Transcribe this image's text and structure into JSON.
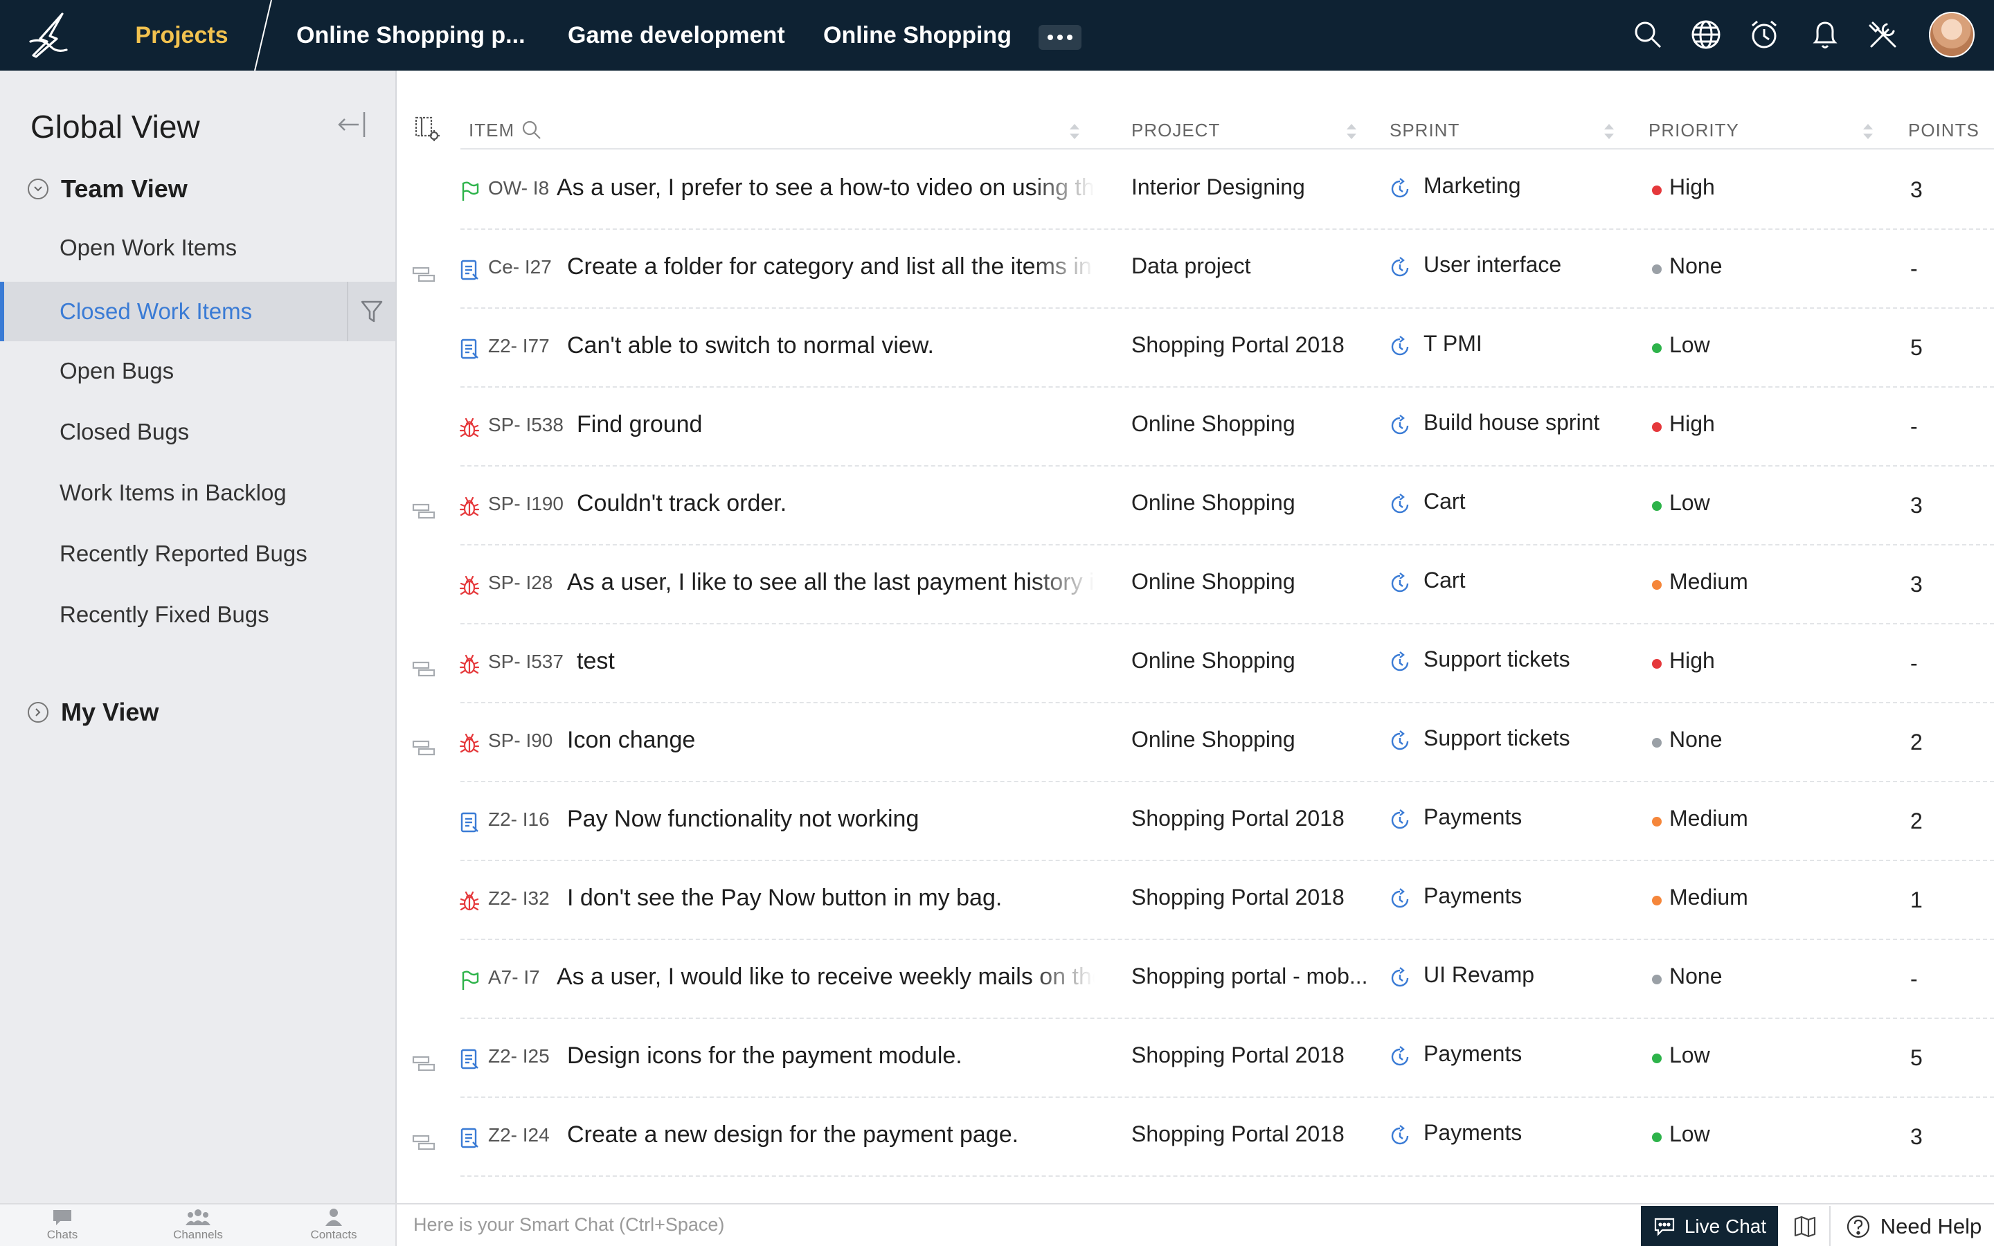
{
  "topbar": {
    "projects_label": "Projects",
    "tabs": [
      "Online Shopping p...",
      "Game development",
      "Online Shopping"
    ],
    "icons": [
      "search-icon",
      "globe-icon",
      "clock-icon",
      "bell-icon",
      "tools-icon"
    ]
  },
  "sidebar": {
    "title": "Global View",
    "team_view": "Team View",
    "items": [
      {
        "label": "Open Work Items",
        "active": false
      },
      {
        "label": "Closed Work Items",
        "active": true
      },
      {
        "label": "Open Bugs",
        "active": false
      },
      {
        "label": "Closed Bugs",
        "active": false
      },
      {
        "label": "Work Items in Backlog",
        "active": false
      },
      {
        "label": "Recently Reported Bugs",
        "active": false
      },
      {
        "label": "Recently Fixed Bugs",
        "active": false
      }
    ],
    "my_view": "My View"
  },
  "table": {
    "columns": [
      "ITEM",
      "PROJECT",
      "SPRINT",
      "PRIORITY",
      "POINTS"
    ],
    "rows": [
      {
        "subtask": false,
        "type": "story",
        "id": "OW- I8",
        "title": "As a user, I prefer to see a how-to video on using the app.",
        "project": "Interior Designing",
        "sprint": "Marketing",
        "priority": "High",
        "points": "3"
      },
      {
        "subtask": true,
        "type": "task",
        "id": "Ce- I27",
        "title": "Create a folder for category and list all the items in it.",
        "project": "Data project",
        "sprint": "User interface",
        "priority": "None",
        "points": "-"
      },
      {
        "subtask": false,
        "type": "task",
        "id": "Z2- I77",
        "title": "Can't able to switch to normal view.",
        "project": "Shopping Portal 2018",
        "sprint": "T PMI",
        "priority": "Low",
        "points": "5"
      },
      {
        "subtask": false,
        "type": "bug",
        "id": "SP- I538",
        "title": "Find ground",
        "project": "Online Shopping",
        "sprint": "Build house sprint",
        "priority": "High",
        "points": "-"
      },
      {
        "subtask": true,
        "type": "bug",
        "id": "SP- I190",
        "title": "Couldn't track order.",
        "project": "Online Shopping",
        "sprint": "Cart",
        "priority": "Low",
        "points": "3"
      },
      {
        "subtask": false,
        "type": "bug",
        "id": "SP- I28",
        "title": "As a user, I like to see all the last payment history in my account.",
        "project": "Online Shopping",
        "sprint": "Cart",
        "priority": "Medium",
        "points": "3"
      },
      {
        "subtask": true,
        "type": "bug",
        "id": "SP- I537",
        "title": "test",
        "project": "Online Shopping",
        "sprint": "Support tickets",
        "priority": "High",
        "points": "-"
      },
      {
        "subtask": true,
        "type": "bug",
        "id": "SP- I90",
        "title": "Icon change",
        "project": "Online Shopping",
        "sprint": "Support tickets",
        "priority": "None",
        "points": "2"
      },
      {
        "subtask": false,
        "type": "task",
        "id": "Z2- I16",
        "title": "Pay Now functionality not working",
        "project": "Shopping Portal 2018",
        "sprint": "Payments",
        "priority": "Medium",
        "points": "2"
      },
      {
        "subtask": false,
        "type": "bug",
        "id": "Z2- I32",
        "title": "I don't see the Pay Now button in my bag.",
        "project": "Shopping Portal 2018",
        "sprint": "Payments",
        "priority": "Medium",
        "points": "1"
      },
      {
        "subtask": false,
        "type": "story",
        "id": "A7- I7",
        "title": "As a user, I would like to receive weekly mails on the latest offers.",
        "project": "Shopping portal - mob...",
        "sprint": "UI Revamp",
        "priority": "None",
        "points": "-"
      },
      {
        "subtask": true,
        "type": "task",
        "id": "Z2- I25",
        "title": "Design icons for the payment module.",
        "project": "Shopping Portal 2018",
        "sprint": "Payments",
        "priority": "Low",
        "points": "5"
      },
      {
        "subtask": true,
        "type": "task",
        "id": "Z2- I24",
        "title": "Create a new design for the payment page.",
        "project": "Shopping Portal 2018",
        "sprint": "Payments",
        "priority": "Low",
        "points": "3"
      }
    ]
  },
  "priority_colors": {
    "High": "#e5383b",
    "Low": "#2db34a",
    "Medium": "#f5863a",
    "None": "#9aa0a6"
  },
  "type_colors": {
    "story": "#2db34a",
    "task": "#3a7bd5",
    "bug": "#e5383b"
  },
  "bottombar": {
    "chats": "Chats",
    "channels": "Channels",
    "contacts": "Contacts",
    "smart_chat_placeholder": "Here is your Smart Chat (Ctrl+Space)",
    "live_chat": "Live Chat",
    "need_help": "Need Help"
  }
}
